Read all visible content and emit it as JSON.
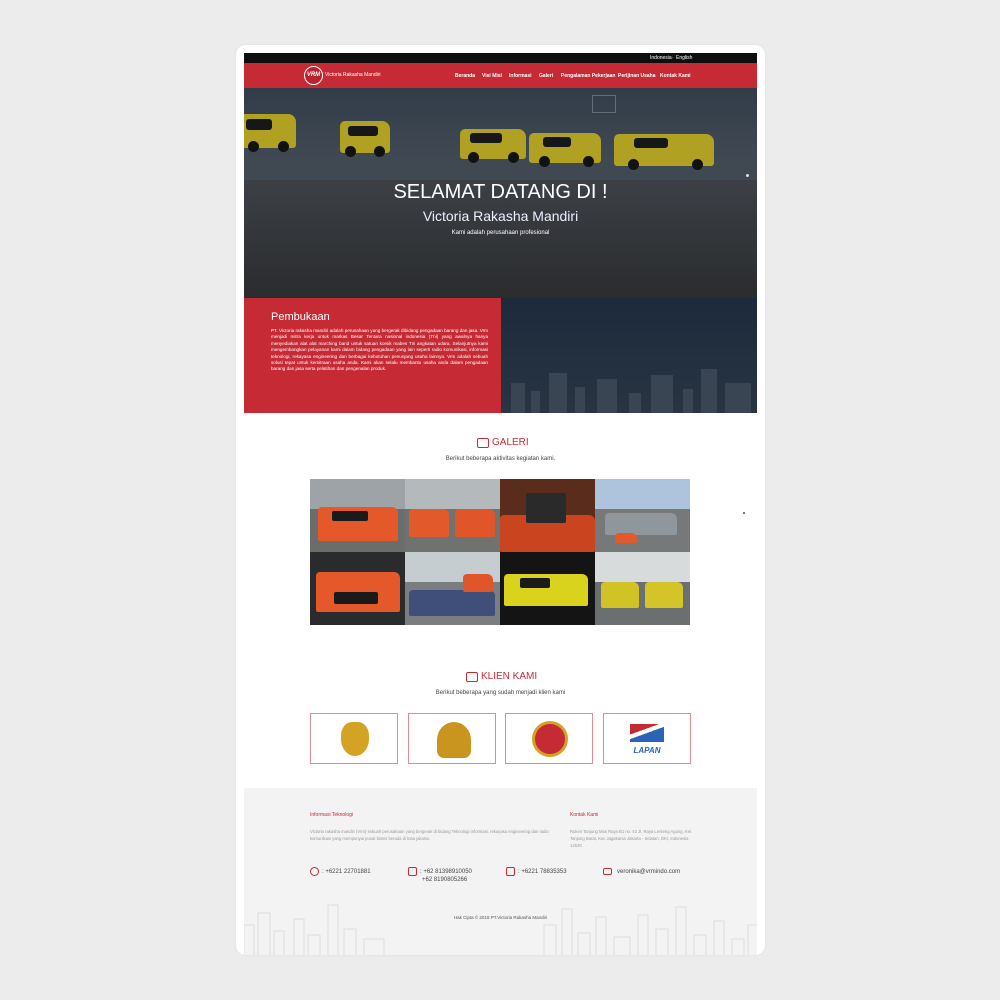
{
  "colors": {
    "brand": "#c52a35",
    "topbar": "#0e0e0e",
    "footer_bg": "#f3f3f3"
  },
  "language": {
    "indonesia": "Indonesia",
    "english": "English",
    "separator": "-"
  },
  "logo": {
    "mark": "VRM",
    "name": "Victoria Rakasha Mandiri"
  },
  "nav": {
    "items": [
      "Beranda",
      "Visi Misi",
      "Informasi",
      "Galeri",
      "Pengalaman Pekerjaan",
      "Perijinan Usaha",
      "Kontak Kami"
    ]
  },
  "hero": {
    "title": "SELAMAT DATANG DI !",
    "subtitle": "Victoria Rakasha Mandiri",
    "description": "Kami adalah perusahaan profesional"
  },
  "intro": {
    "heading": "Pembukaan",
    "body": "PT. Victoria rakasha mandiri adalah perusahaan yang bergerak dibidang pengadaan barang dan jasa. Vrm menjadi mitra kerja untuk markas Besar Tentara nasional indonesia (Tni) yang awalnya hanya menyediakan alat alat marching band untuk satuan korsik mabes Tni angkatan udara. Selanjutnya kami mengembangkan pelayanan kami dalam bidang pengadaan yang lain seperti radio komunikasi, informasi teknologi, rekayasa engineering dan berbagai kebutuhan penunjang usaha lainnya. Vrm adalah sebuah solusi tepat untuk kemitraan usaha anda. Kami akan selalu membantu usaha anda dalam pengadaan barang dan jasa serta pelatihan dan pengenalan produk."
  },
  "gallery": {
    "icon": "gallery-icon",
    "title": "GALERI",
    "subtitle": "Berikut beberapa aktivitas kegiatan kami."
  },
  "clients": {
    "icon": "handshake-icon",
    "title": "KLIEN KAMI",
    "subtitle": "Berikut beberapa yang sudah menjadi klien kami",
    "logos": [
      "navy-emblem",
      "air-force-emblem",
      "ministry-emblem",
      "lapan-logo"
    ],
    "lapan_text": "LAPAN"
  },
  "footer": {
    "info_heading": "Informasi Teknologi",
    "info_text": "Victoria rakasha mandiri (Vrm) sebuah perusahaan yang bergerak di bidang Teknologi Informasi, rekayasa engineering dan radio komunikasi yang mempunyai pusat bisnis berada di kota jakarta.",
    "contact_heading": "Kontak Kami",
    "address": "Ruken Tanjung Mas Raya B1 no. 43 Jl. Raya Lenteng Agung, Kel. Tanjung Barat, Kec Jagakarsa Jakarta - Selatan, DKI, Indonesia 12530",
    "phone": ": +6221 22701881",
    "mobile_1": ": +62 81398910050",
    "mobile_2": "+62 8190805266",
    "fax": ": +6221 78835353",
    "email": "veronika@vrmindo.com",
    "copyright": "Hak Cipta © 2018 PT.Victoria Rakasha Mandiri"
  }
}
